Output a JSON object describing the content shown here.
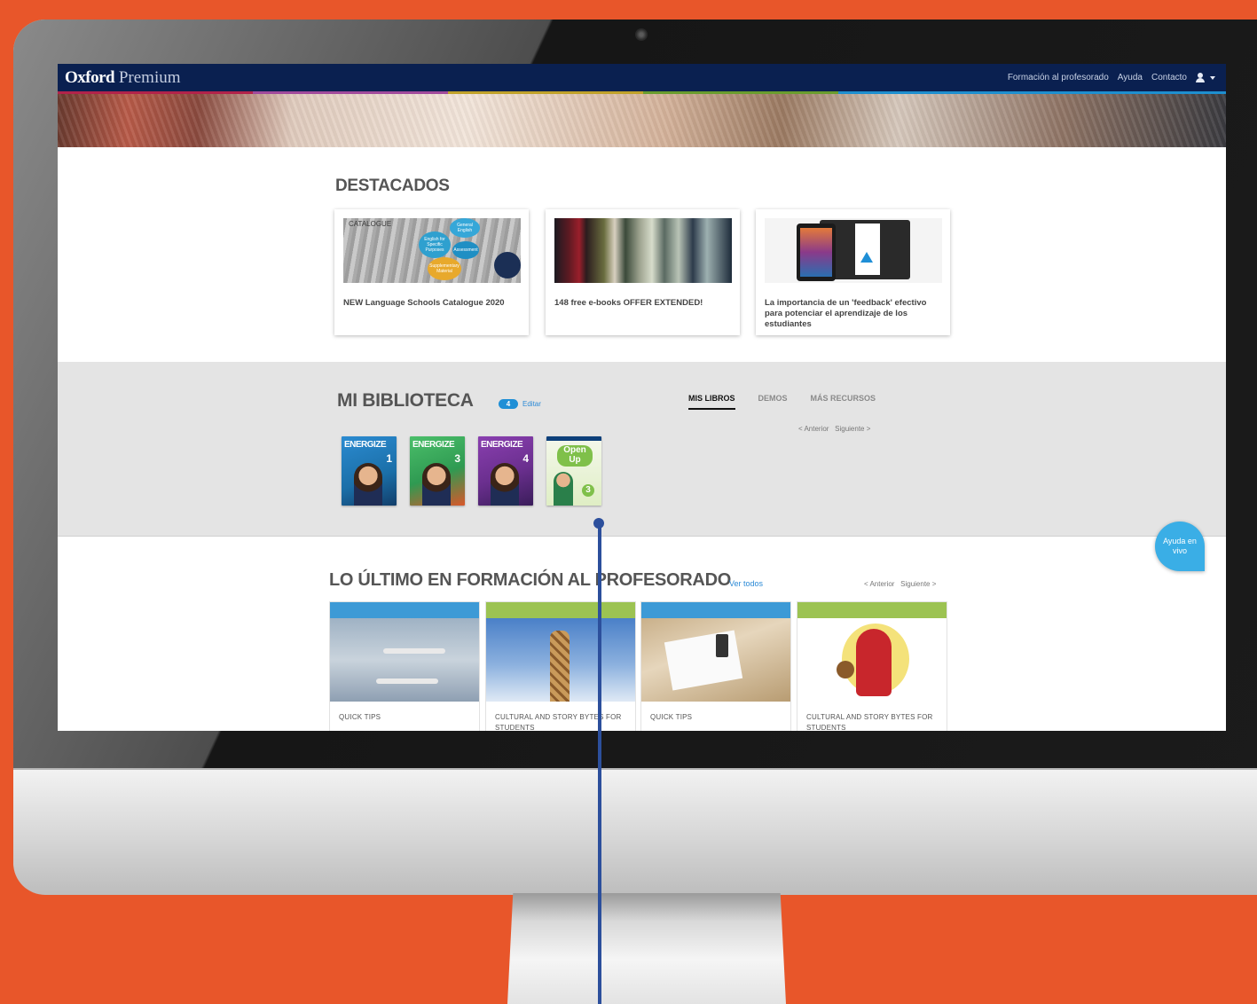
{
  "nav": {
    "brand_bold": "Oxford",
    "brand_light": "Premium",
    "links": [
      "Formación al profesorado",
      "Ayuda",
      "Contacto"
    ],
    "user_icon": "user-icon",
    "dropdown_icon": "caret-down-icon",
    "stripe_colors": [
      "#b2234a",
      "#a14a9c",
      "#c1a22a",
      "#6a9d2e",
      "#1e8fcf"
    ]
  },
  "destacados": {
    "title": "DESTACADOS",
    "cards": [
      {
        "caption": "NEW Language Schools Catalogue 2020",
        "image_text": {
          "overlay": "CATALOGUE",
          "bubbles": [
            "General English",
            "English for Specific Purposes",
            "Assessment",
            "Supplementary Material"
          ]
        }
      },
      {
        "caption": "148 free e-books OFFER EXTENDED!"
      },
      {
        "caption": "La importancia de un 'feedback' efectivo para potenciar el aprendizaje de los estudiantes"
      }
    ]
  },
  "biblioteca": {
    "title": "MI BIBLIOTECA",
    "count": "4",
    "edit_label": "Editar",
    "tabs": [
      "MIS LIBROS",
      "DEMOS",
      "MÁS RECURSOS"
    ],
    "active_tab": "MIS LIBROS",
    "prev_label": "< Anterior",
    "next_label": "Siguiente >",
    "books": [
      {
        "series": "ENERGIZE",
        "level": "1",
        "cover_color": "#1b6fa8"
      },
      {
        "series": "ENERGIZE",
        "level": "3",
        "cover_color": "#2f9a52"
      },
      {
        "series": "ENERGIZE",
        "level": "4",
        "cover_color": "#6a2f8e"
      },
      {
        "series": "Open Up",
        "level": "3",
        "cover_color": "#cfe6a8"
      }
    ]
  },
  "formacion": {
    "title": "LO ÚLTIMO EN FORMACIÓN AL PROFESORADO",
    "see_all": "Ver todos",
    "prev_label": "< Anterior",
    "next_label": "Siguiente >",
    "courses": [
      {
        "category": "QUICK TIPS",
        "bar_color": "#3d9ad6"
      },
      {
        "category": "CULTURAL AND STORY BYTES FOR STUDENTS",
        "bar_color": "#9cc352"
      },
      {
        "category": "QUICK TIPS",
        "bar_color": "#3d9ad6"
      },
      {
        "category": "CULTURAL AND STORY BYTES FOR STUDENTS",
        "bar_color": "#9cc352"
      }
    ]
  },
  "help": {
    "label": "Ayuda en vivo"
  },
  "colors": {
    "background": "#e8562a",
    "navbar": "#0a2050",
    "accent": "#1f8fd6",
    "pointer": "#2c4f9c"
  }
}
